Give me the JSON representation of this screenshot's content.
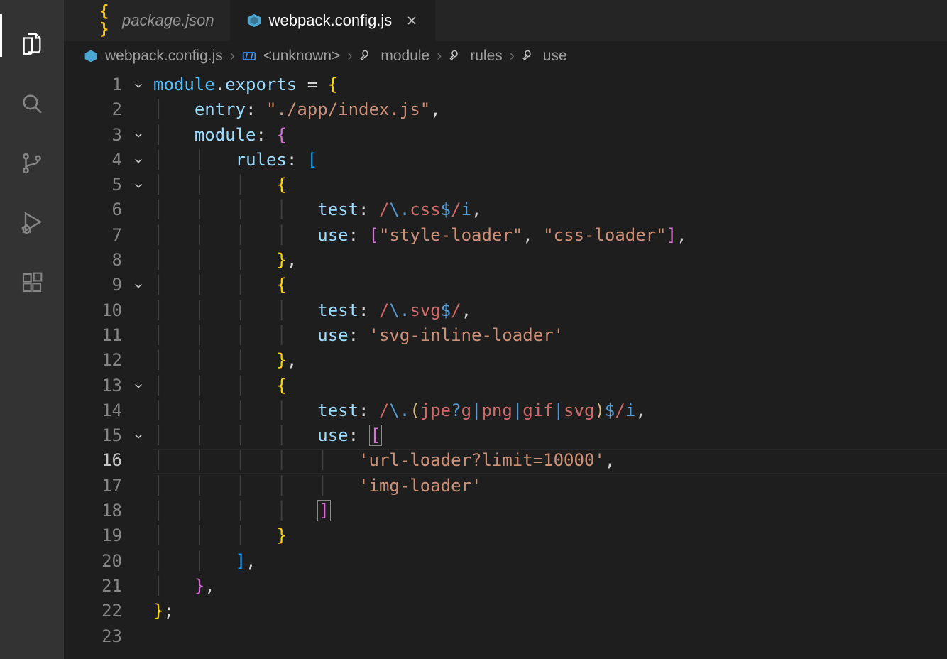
{
  "activitybar": {
    "items": [
      "explorer",
      "search",
      "source-control",
      "run-debug",
      "extensions"
    ],
    "active_index": 0
  },
  "tabs": [
    {
      "label": "package.json",
      "icon": "json-braces-icon",
      "active": false,
      "italic": true
    },
    {
      "label": "webpack.config.js",
      "icon": "webpack-cube-icon",
      "active": true,
      "italic": false
    }
  ],
  "breadcrumbs": [
    {
      "icon": "webpack-cube-icon",
      "label": "webpack.config.js"
    },
    {
      "icon": "symbol-module-icon",
      "label": "<unknown>"
    },
    {
      "icon": "wrench-icon",
      "label": "module"
    },
    {
      "icon": "wrench-icon",
      "label": "rules"
    },
    {
      "icon": "wrench-icon",
      "label": "use"
    }
  ],
  "editor": {
    "current_line": 16,
    "fold_lines": [
      1,
      3,
      4,
      5,
      9,
      13,
      15
    ],
    "line_numbers": [
      "1",
      "2",
      "3",
      "4",
      "5",
      "6",
      "7",
      "8",
      "9",
      "10",
      "11",
      "12",
      "13",
      "14",
      "15",
      "16",
      "17",
      "18",
      "19",
      "20",
      "21",
      "22",
      "23"
    ],
    "lines": [
      [
        {
          "t": "module",
          "c": "tk-var"
        },
        {
          "t": ".",
          "c": "tk-punct"
        },
        {
          "t": "exports",
          "c": "tk-prop"
        },
        {
          "t": " ",
          "c": ""
        },
        {
          "t": "=",
          "c": "tk-op"
        },
        {
          "t": " ",
          "c": ""
        },
        {
          "t": "{",
          "c": "tk-brkt1"
        }
      ],
      [
        {
          "t": "    ",
          "c": ""
        },
        {
          "t": "entry",
          "c": "tk-prop"
        },
        {
          "t": ":",
          "c": "tk-punct"
        },
        {
          "t": " ",
          "c": ""
        },
        {
          "t": "\"./app/index.js\"",
          "c": "tk-str"
        },
        {
          "t": ",",
          "c": "tk-punct"
        }
      ],
      [
        {
          "t": "    ",
          "c": ""
        },
        {
          "t": "module",
          "c": "tk-prop"
        },
        {
          "t": ":",
          "c": "tk-punct"
        },
        {
          "t": " ",
          "c": ""
        },
        {
          "t": "{",
          "c": "tk-brkt2"
        }
      ],
      [
        {
          "t": "        ",
          "c": ""
        },
        {
          "t": "rules",
          "c": "tk-prop"
        },
        {
          "t": ":",
          "c": "tk-punct"
        },
        {
          "t": " ",
          "c": ""
        },
        {
          "t": "[",
          "c": "tk-brkt3"
        }
      ],
      [
        {
          "t": "            ",
          "c": ""
        },
        {
          "t": "{",
          "c": "tk-brkt1"
        }
      ],
      [
        {
          "t": "                ",
          "c": ""
        },
        {
          "t": "test",
          "c": "tk-prop"
        },
        {
          "t": ":",
          "c": "tk-punct"
        },
        {
          "t": " ",
          "c": ""
        },
        {
          "t": "/",
          "c": "tk-regex"
        },
        {
          "t": "\\.",
          "c": "tk-rgx-esc"
        },
        {
          "t": "css",
          "c": "tk-regex"
        },
        {
          "t": "$",
          "c": "tk-rgx-esc"
        },
        {
          "t": "/",
          "c": "tk-regex"
        },
        {
          "t": "i",
          "c": "tk-rgx-fl"
        },
        {
          "t": ",",
          "c": "tk-punct"
        }
      ],
      [
        {
          "t": "                ",
          "c": ""
        },
        {
          "t": "use",
          "c": "tk-prop"
        },
        {
          "t": ":",
          "c": "tk-punct"
        },
        {
          "t": " ",
          "c": ""
        },
        {
          "t": "[",
          "c": "tk-brkt2"
        },
        {
          "t": "\"style-loader\"",
          "c": "tk-str"
        },
        {
          "t": ",",
          "c": "tk-punct"
        },
        {
          "t": " ",
          "c": ""
        },
        {
          "t": "\"css-loader\"",
          "c": "tk-str"
        },
        {
          "t": "]",
          "c": "tk-brkt2"
        },
        {
          "t": ",",
          "c": "tk-punct"
        }
      ],
      [
        {
          "t": "            ",
          "c": ""
        },
        {
          "t": "}",
          "c": "tk-brkt1"
        },
        {
          "t": ",",
          "c": "tk-punct"
        }
      ],
      [
        {
          "t": "            ",
          "c": ""
        },
        {
          "t": "{",
          "c": "tk-brkt1"
        }
      ],
      [
        {
          "t": "                ",
          "c": ""
        },
        {
          "t": "test",
          "c": "tk-prop"
        },
        {
          "t": ":",
          "c": "tk-punct"
        },
        {
          "t": " ",
          "c": ""
        },
        {
          "t": "/",
          "c": "tk-regex"
        },
        {
          "t": "\\.",
          "c": "tk-rgx-esc"
        },
        {
          "t": "svg",
          "c": "tk-regex"
        },
        {
          "t": "$",
          "c": "tk-rgx-esc"
        },
        {
          "t": "/",
          "c": "tk-regex"
        },
        {
          "t": ",",
          "c": "tk-punct"
        }
      ],
      [
        {
          "t": "                ",
          "c": ""
        },
        {
          "t": "use",
          "c": "tk-prop"
        },
        {
          "t": ":",
          "c": "tk-punct"
        },
        {
          "t": " ",
          "c": ""
        },
        {
          "t": "'svg-inline-loader'",
          "c": "tk-str"
        }
      ],
      [
        {
          "t": "            ",
          "c": ""
        },
        {
          "t": "}",
          "c": "tk-brkt1"
        },
        {
          "t": ",",
          "c": "tk-punct"
        }
      ],
      [
        {
          "t": "            ",
          "c": ""
        },
        {
          "t": "{",
          "c": "tk-brkt1"
        }
      ],
      [
        {
          "t": "                ",
          "c": ""
        },
        {
          "t": "test",
          "c": "tk-prop"
        },
        {
          "t": ":",
          "c": "tk-punct"
        },
        {
          "t": " ",
          "c": ""
        },
        {
          "t": "/",
          "c": "tk-regex"
        },
        {
          "t": "\\.",
          "c": "tk-rgx-esc"
        },
        {
          "t": "(",
          "c": "tk-rgx-br"
        },
        {
          "t": "jpe",
          "c": "tk-regex"
        },
        {
          "t": "?",
          "c": "tk-rgx-esc"
        },
        {
          "t": "g",
          "c": "tk-regex"
        },
        {
          "t": "|",
          "c": "tk-rgx-esc"
        },
        {
          "t": "png",
          "c": "tk-regex"
        },
        {
          "t": "|",
          "c": "tk-rgx-esc"
        },
        {
          "t": "gif",
          "c": "tk-regex"
        },
        {
          "t": "|",
          "c": "tk-rgx-esc"
        },
        {
          "t": "svg",
          "c": "tk-regex"
        },
        {
          "t": ")",
          "c": "tk-rgx-br"
        },
        {
          "t": "$",
          "c": "tk-rgx-esc"
        },
        {
          "t": "/",
          "c": "tk-regex"
        },
        {
          "t": "i",
          "c": "tk-rgx-fl"
        },
        {
          "t": ",",
          "c": "tk-punct"
        }
      ],
      [
        {
          "t": "                ",
          "c": ""
        },
        {
          "t": "use",
          "c": "tk-prop"
        },
        {
          "t": ":",
          "c": "tk-punct"
        },
        {
          "t": " ",
          "c": ""
        },
        {
          "t": "[",
          "c": "tk-brkt2 cursorbrk"
        }
      ],
      [
        {
          "t": "                    ",
          "c": ""
        },
        {
          "t": "'url-loader?limit=10000'",
          "c": "tk-str"
        },
        {
          "t": ",",
          "c": "tk-punct"
        }
      ],
      [
        {
          "t": "                    ",
          "c": ""
        },
        {
          "t": "'img-loader'",
          "c": "tk-str"
        }
      ],
      [
        {
          "t": "                ",
          "c": ""
        },
        {
          "t": "]",
          "c": "tk-brkt2 cursorbrk"
        }
      ],
      [
        {
          "t": "            ",
          "c": ""
        },
        {
          "t": "}",
          "c": "tk-brkt1"
        }
      ],
      [
        {
          "t": "        ",
          "c": ""
        },
        {
          "t": "]",
          "c": "tk-brkt3"
        },
        {
          "t": ",",
          "c": "tk-punct"
        }
      ],
      [
        {
          "t": "    ",
          "c": ""
        },
        {
          "t": "}",
          "c": "tk-brkt2"
        },
        {
          "t": ",",
          "c": "tk-punct"
        }
      ],
      [
        {
          "t": "}",
          "c": "tk-brkt1"
        },
        {
          "t": ";",
          "c": "tk-punct"
        }
      ],
      []
    ]
  }
}
